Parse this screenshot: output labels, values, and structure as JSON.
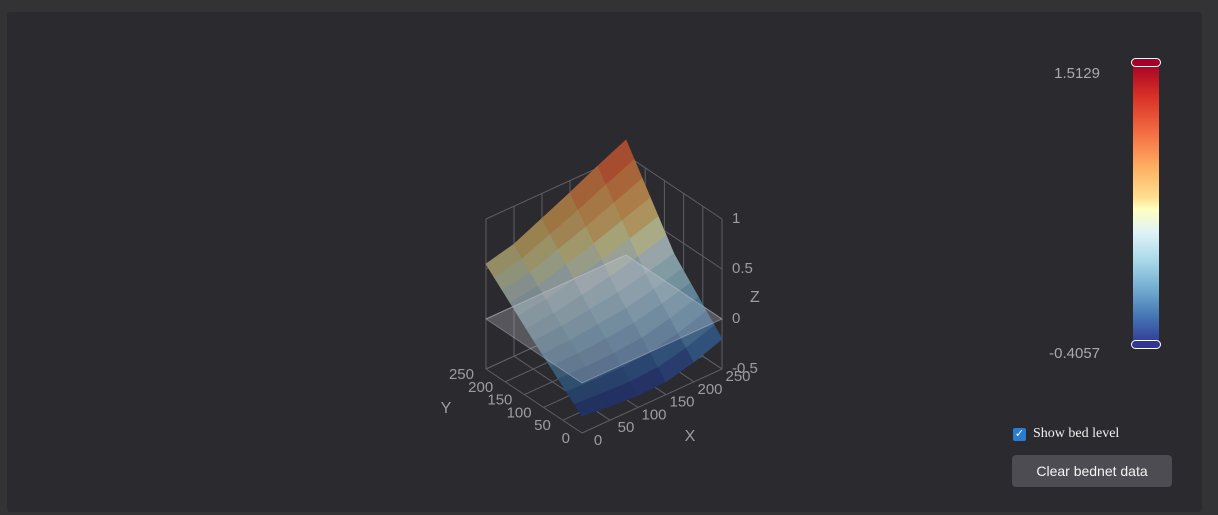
{
  "chart_data": {
    "type": "surface3d",
    "title": "",
    "x_axis": {
      "label": "X",
      "ticks": [
        "0",
        "50",
        "100",
        "150",
        "200",
        "250"
      ],
      "range": [
        0,
        250
      ]
    },
    "y_axis": {
      "label": "Y",
      "ticks": [
        "0",
        "50",
        "100",
        "150",
        "200",
        "250"
      ],
      "range": [
        0,
        250
      ]
    },
    "z_axis": {
      "label": "Z",
      "ticks": [
        "-0.5",
        "0",
        "0.5",
        "1"
      ],
      "range": [
        -0.5,
        1
      ]
    },
    "surface": {
      "x": [
        0,
        50,
        100,
        150,
        200,
        250
      ],
      "y": [
        0,
        125,
        250
      ],
      "z": [
        [
          -0.33,
          0.1,
          0.55
        ],
        [
          -0.36,
          0.12,
          0.62
        ],
        [
          -0.38,
          0.16,
          0.75
        ],
        [
          -0.37,
          0.2,
          0.88
        ],
        [
          -0.3,
          0.26,
          1.02
        ],
        [
          -0.2,
          0.33,
          1.15
        ]
      ]
    },
    "reference_plane_z": 0,
    "colorscale": "RdYlBu_r",
    "colorbar": {
      "max_label": "1.5129",
      "min_label": "-0.4057",
      "max": 1.5129,
      "min": -0.4057
    },
    "grid": true
  },
  "controls": {
    "show_bed_level_label": "Show bed level",
    "show_bed_level_checked": true,
    "clear_button_label": "Clear bednet data"
  },
  "colors": {
    "background": "#2b2a2f",
    "grid": "#5e5e63",
    "tick_text": "#9c9ca1"
  }
}
